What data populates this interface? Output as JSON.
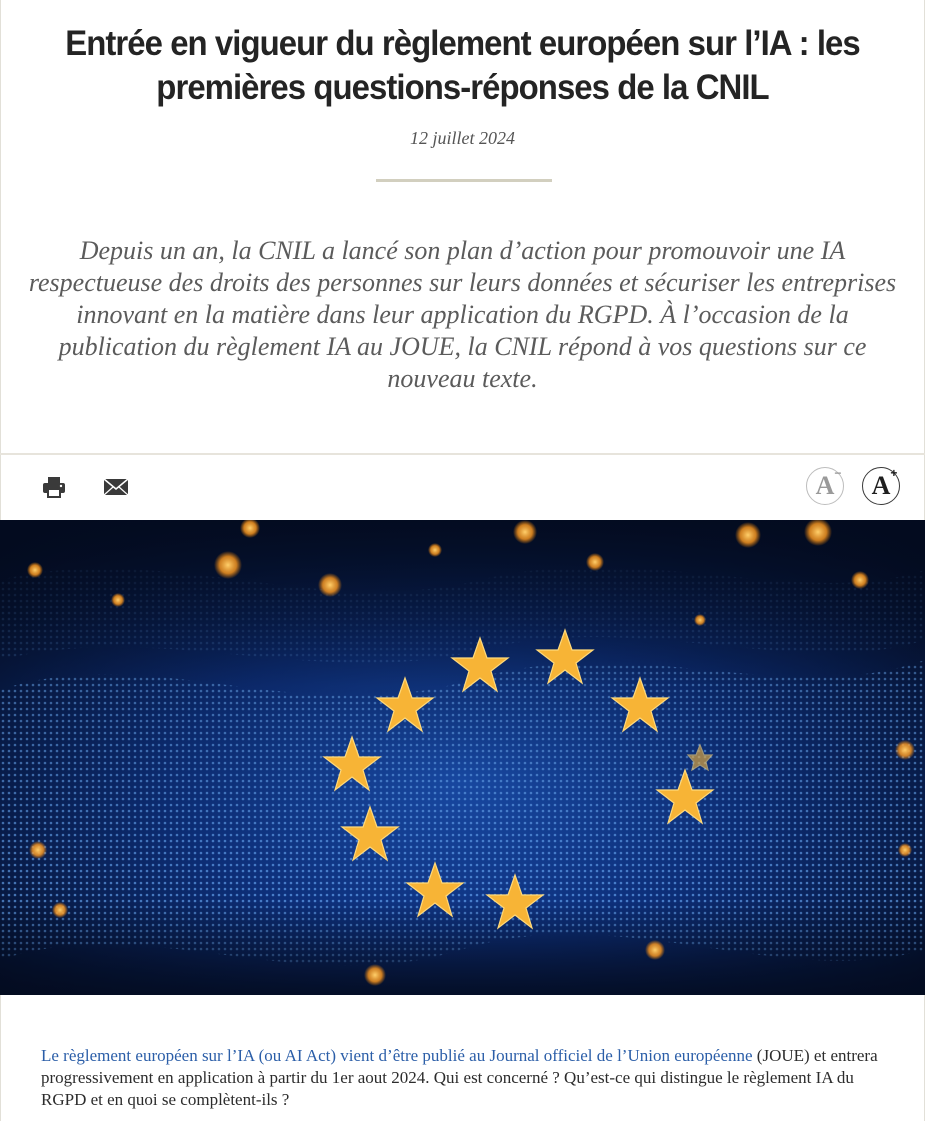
{
  "article": {
    "title": "Entrée en vigueur du règlement européen sur l’IA : les premières questions-réponses de la CNIL",
    "date": "12 juillet 2024",
    "chapo": "Depuis un an, la CNIL a lancé son plan d’action pour promouvoir une IA respectueuse des droits des personnes sur leurs données et sécuriser les entreprises innovant en la matière dans leur application du RGPD. À l’occasion de la publication du règlement IA au JOUE, la CNIL répond à vos questions sur ce nouveau texte.",
    "intro_link": "Le règlement européen sur l’IA (ou AI Act) vient d’être publié au Journal officiel de l’Union européenne",
    "intro_rest": " (JOUE) et entrera progressivement en application à partir du 1er aout 2024. Qui est concerné ? Qu’est-ce qui distingue le règlement IA du RGPD et en quoi se complètent-ils ?"
  },
  "toolbar": {
    "print_icon": "print-icon",
    "mail_icon": "mail-icon",
    "font_decrease_label": "A",
    "font_decrease_sign": "−",
    "font_increase_label": "A",
    "font_increase_sign": "+"
  },
  "colors": {
    "link": "#2b5ea8",
    "divider": "#d2cfbf",
    "star": "#f5a623",
    "hero_bg": "#061634"
  }
}
